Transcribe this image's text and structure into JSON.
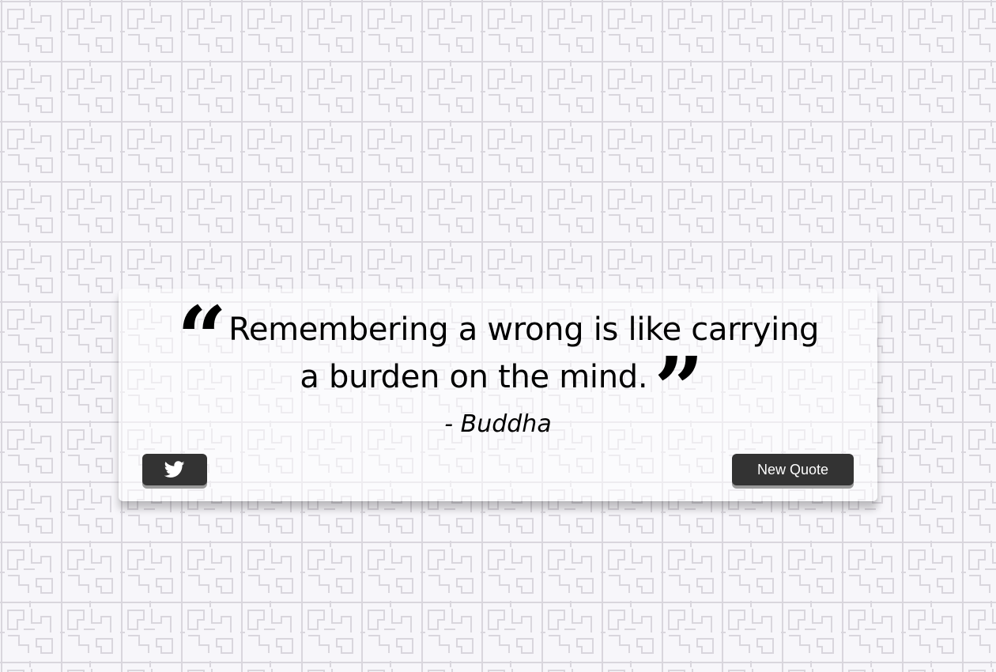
{
  "quote": {
    "open_mark": "“",
    "text": "Remembering a wrong is like carrying a burden on the mind.",
    "close_mark": "”",
    "author": "- Buddha"
  },
  "actions": {
    "tweet_icon": "twitter-icon",
    "new_quote_label": "New Quote"
  },
  "colors": {
    "background": "#f7f6fa",
    "pattern_stroke": "#d9d6dd",
    "card": "#ffffff",
    "button": "#333333",
    "button_text": "#ffffff",
    "text": "#000000"
  }
}
